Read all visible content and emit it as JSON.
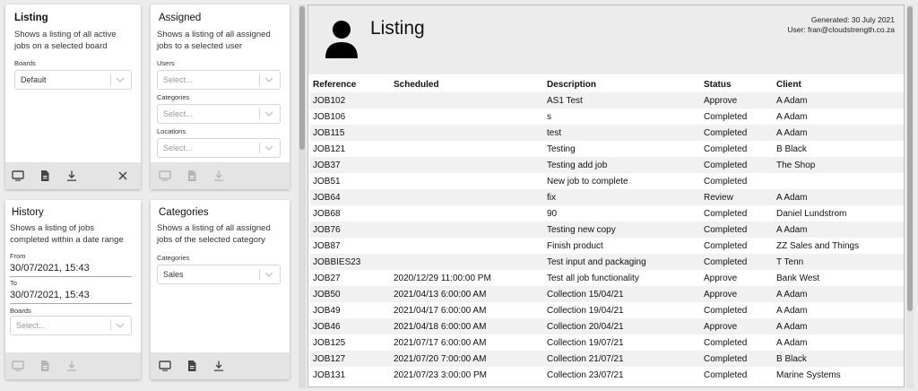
{
  "cards": {
    "listing": {
      "title": "Listing",
      "desc": "Shows a listing of all active jobs on a selected board",
      "boards_label": "Boards",
      "boards_value": "Default"
    },
    "assigned": {
      "title": "Assigned",
      "desc": "Shows a listing of all assigned jobs to a selected user",
      "users_label": "Users",
      "users_placeholder": "Select...",
      "categories_label": "Categories",
      "categories_placeholder": "Select...",
      "locations_label": "Locations",
      "locations_placeholder": "Select..."
    },
    "history": {
      "title": "History",
      "desc": "Shows a listing of jobs completed within a date range",
      "from_label": "From",
      "from_value": "30/07/2021, 15:43",
      "to_label": "To",
      "to_value": "30/07/2021, 15:43",
      "boards_label": "Boards",
      "boards_placeholder": "Select..."
    },
    "categories": {
      "title": "Categories",
      "desc": "Shows a listing of all assigned jobs of the selected category",
      "categories_label": "Categories",
      "categories_value": "Sales"
    }
  },
  "report": {
    "title": "Listing",
    "generated": "Generated: 30 July 2021",
    "user": "User: fran@cloudstrength.co.za",
    "columns": [
      "Reference",
      "Scheduled",
      "Description",
      "Status",
      "Client"
    ],
    "rows": [
      [
        "JOB102",
        "",
        "AS1 Test",
        "Approve",
        "A Adam"
      ],
      [
        "JOB106",
        "",
        "s",
        "Completed",
        "A Adam"
      ],
      [
        "JOB115",
        "",
        "test",
        "Completed",
        "A Adam"
      ],
      [
        "JOB121",
        "",
        "Testing",
        "Completed",
        "B Black"
      ],
      [
        "JOB37",
        "",
        "Testing add job",
        "Completed",
        "The Shop"
      ],
      [
        "JOB51",
        "",
        "New job to complete",
        "Completed",
        ""
      ],
      [
        "JOB64",
        "",
        "fix",
        "Review",
        "A Adam"
      ],
      [
        "JOB68",
        "",
        "90",
        "Completed",
        "Daniel Lundstrom"
      ],
      [
        "JOB76",
        "",
        "Testing new copy",
        "Completed",
        "A Adam"
      ],
      [
        "JOB87",
        "",
        "Finish product",
        "Completed",
        "ZZ Sales and Things"
      ],
      [
        "JOBBIES23",
        "",
        "Test input and packaging",
        "Completed",
        "T Tenn"
      ],
      [
        "JOB27",
        "2020/12/29 11:00:00 PM",
        "Test all job functionality",
        "Approve",
        "Bank West"
      ],
      [
        "JOB50",
        "2021/04/13 6:00:00 AM",
        "Collection 15/04/21",
        "Approve",
        "A Adam"
      ],
      [
        "JOB49",
        "2021/04/17 6:00:00 AM",
        "Collection 19/04/21",
        "Completed",
        "A Adam"
      ],
      [
        "JOB46",
        "2021/04/18 6:00:00 AM",
        "Collection 20/04/21",
        "Approve",
        "A Adam"
      ],
      [
        "JOB125",
        "2021/07/17 6:00:00 AM",
        "Collection 19/07/21",
        "Completed",
        "A Adam"
      ],
      [
        "JOB127",
        "2021/07/20 7:00:00 AM",
        "Collection 21/07/21",
        "Completed",
        "B Black"
      ],
      [
        "JOB131",
        "2021/07/23 3:00:00 PM",
        "Collection 23/07/21",
        "Completed",
        "Marine Systems"
      ]
    ]
  },
  "icons": {
    "monitor": "monitor-icon",
    "document": "document-icon",
    "download": "download-icon",
    "close": "close-icon",
    "chevron": "chevron-down-icon",
    "avatar": "person-avatar-icon"
  },
  "colors": {
    "enabled_icon": "#444444",
    "disabled_icon": "#b5b5b5",
    "footer_bg": "#e4e4e4",
    "page_bg": "#ececec"
  }
}
